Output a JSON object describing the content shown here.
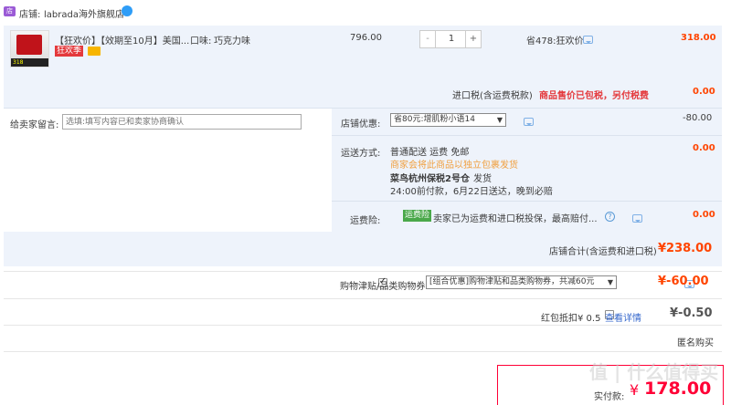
{
  "shop": {
    "label": "店铺:",
    "name": "labrada海外旗舰店"
  },
  "item": {
    "title": "【狂欢价】【效期至10月】美国...",
    "spec_label": "口味:",
    "spec_value": "巧克力味",
    "badge": "狂欢季",
    "price": "796.00",
    "qty": "1",
    "saving": "省478:狂欢价",
    "subtotal": "318.00",
    "thumb_num": "318"
  },
  "tax": {
    "label": "进口税(含运费税款)",
    "note": "商品售价已包税，另付税费",
    "value": "0.00"
  },
  "remark": {
    "label": "给卖家留言:",
    "placeholder": "选填:填写内容已和卖家协商确认"
  },
  "discount": {
    "label": "店铺优惠:",
    "selected": "省80元:增肌粉小语14",
    "value": "-80.00"
  },
  "shipping": {
    "label": "运送方式:",
    "method": "普通配送 运费 免邮",
    "notice": "商家会将此商品以独立包裹发货",
    "warehouse": "菜鸟杭州保税2号仓",
    "ship_text": "发货",
    "eta": "24:00前付款，6月22日送达，晚到必赔",
    "value": "0.00"
  },
  "insurance": {
    "label": "运费险:",
    "tag": "运费险",
    "desc": "卖家已为运费和进口税投保，最高赔付...",
    "value": "0.00"
  },
  "shop_total": {
    "label": "店铺合计(含运费和进口税)",
    "value": "¥238.00"
  },
  "coupon": {
    "label": "购物津贴/品类购物券",
    "selected": "[组合优惠]购物津贴和品类购物券，共减60元",
    "value": "¥-60.00"
  },
  "redpacket": {
    "label": "红包抵扣¥ 0.5",
    "link": "查看详情",
    "value": "¥-0.50"
  },
  "anonymous": {
    "label": "匿名购买"
  },
  "pay": {
    "label": "实付款:",
    "symbol": "¥",
    "value": "178.00"
  },
  "watermark": "值 | 什么值得买",
  "colors": {
    "accent": "#ff0036",
    "panel": "#eef3fb",
    "link": "#3366cc"
  }
}
